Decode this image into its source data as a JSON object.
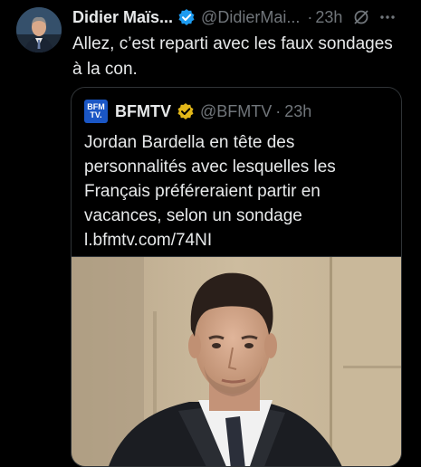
{
  "tweet": {
    "author_name": "Didier Maïs...",
    "handle": "@DidierMai...",
    "separator": "·",
    "time": "23h",
    "text": "Allez, c’est reparti avec les faux sondages à la con.",
    "verified_badge_color": "#1d9bf0",
    "icons": [
      "verified-badge-icon",
      "grok-icon",
      "more-options-icon"
    ]
  },
  "quote": {
    "logo_line1": "BFM",
    "logo_line2": "TV.",
    "author_name": "BFMTV",
    "handle": "@BFMTV",
    "separator": "·",
    "time": "23h",
    "text_lines": [
      "Jordan Bardella en tête des",
      "personnalités avec lesquelles les",
      "Français préféreraient partir en",
      "vacances, selon un sondage",
      "l.bfmtv.com/74NI"
    ],
    "verified_badge_color": "#e2b719",
    "logo_color": "#1a56c5"
  },
  "colors": {
    "background": "#000000",
    "text": "#e7e9ea",
    "muted": "#71767b",
    "border": "#2f3336"
  }
}
